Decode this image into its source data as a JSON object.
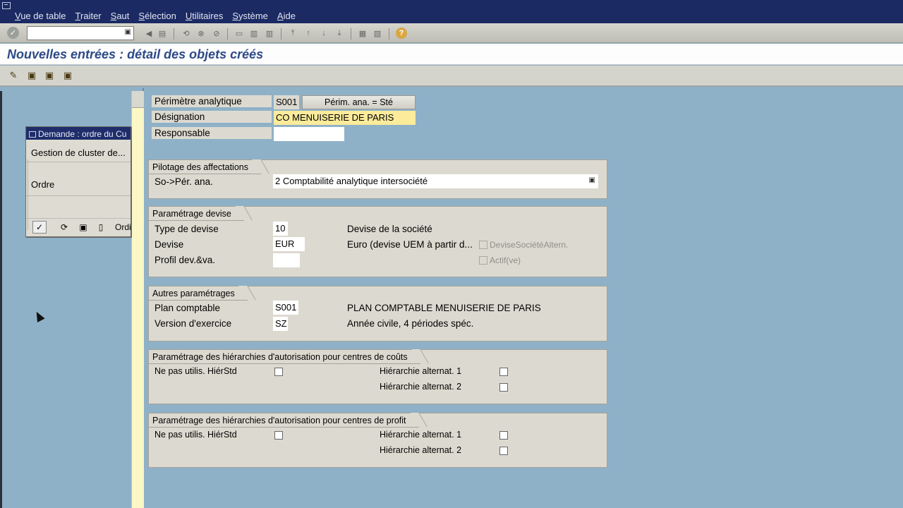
{
  "menu": [
    "Vue de table",
    "Traiter",
    "Saut",
    "Sélection",
    "Utilitaires",
    "Système",
    "Aide"
  ],
  "title": "Nouvelles entrées : détail des objets créés",
  "nav": {
    "dialog_title": "Demande : ordre du Cu",
    "row1": "Gestion de cluster de...",
    "row2": "Ordre",
    "btn_last": "Ordi"
  },
  "header": {
    "perimetre_label": "Périmètre analytique",
    "perimetre_value": "S001",
    "perimetre_button": "Périm. ana. = Sté",
    "designation_label": "Désignation",
    "designation_value": "CO MENUISERIE DE PARIS",
    "responsable_label": "Responsable",
    "responsable_value": ""
  },
  "groups": {
    "pilotage": {
      "title": "Pilotage des affectations",
      "label": "So->Pér. ana.",
      "value": "2 Comptabilité analytique intersociété"
    },
    "devise": {
      "title": "Paramétrage devise",
      "type_label": "Type de devise",
      "type_value": "10",
      "type_desc": "Devise de la société",
      "devise_label": "Devise",
      "devise_value": "EUR",
      "devise_desc": "Euro (devise UEM à partir d...",
      "profil_label": "Profil dev.&va.",
      "profil_value": "",
      "cb1_label": "DeviseSociétéAltern.",
      "cb2_label": "Actif(ve)"
    },
    "autres": {
      "title": "Autres paramétrages",
      "plan_label": "Plan comptable",
      "plan_value": "S001",
      "plan_desc": "PLAN COMPTABLE MENUISERIE DE PARIS",
      "version_label": "Version d'exercice",
      "version_value": "SZ",
      "version_desc": "Année civile, 4 périodes spéc."
    },
    "hier_couts": {
      "title": "Paramétrage des hiérarchies d'autorisation pour centres de coûts",
      "std_label": "Ne pas utilis. HiérStd",
      "alt1_label": "Hiérarchie alternat. 1",
      "alt2_label": "Hiérarchie alternat. 2"
    },
    "hier_profit": {
      "title": "Paramétrage des hiérarchies d'autorisation pour centres de profit",
      "std_label": "Ne pas utilis. HiérStd",
      "alt1_label": "Hiérarchie alternat. 1",
      "alt2_label": "Hiérarchie alternat. 2"
    }
  },
  "colors": {
    "menubar": "#1c2a63",
    "background": "#8fb1c7",
    "panel": "#dcdad0",
    "required_field": "#fbeb9b",
    "title_text": "#2d4a87"
  },
  "icons": [
    "enter-icon",
    "save-icon",
    "back-icon",
    "exit-icon",
    "cancel-icon",
    "print-icon",
    "find-icon",
    "help-icon"
  ]
}
